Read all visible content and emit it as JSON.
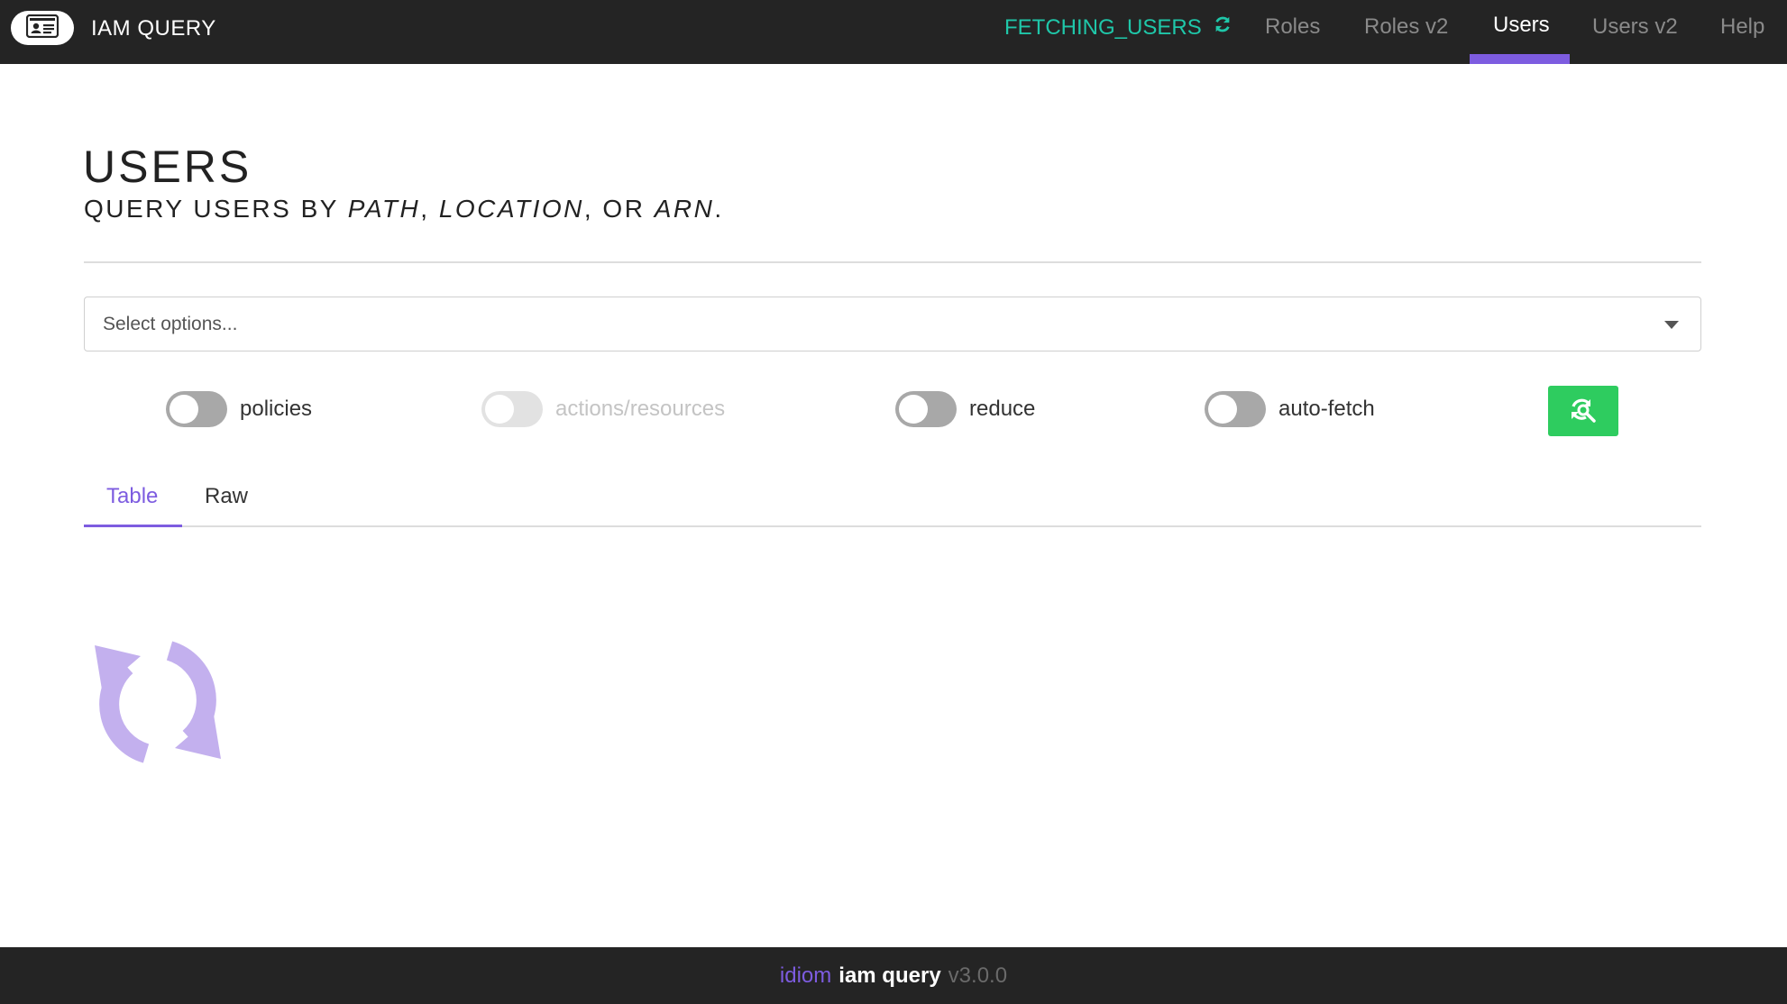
{
  "header": {
    "logo_icon": "id-card-icon",
    "title": "IAM QUERY",
    "status": {
      "text": "FETCHING_USERS",
      "icon": "refresh-icon",
      "color": "#1fc7a9"
    },
    "nav": [
      {
        "label": "Roles",
        "active": false
      },
      {
        "label": "Roles v2",
        "active": false
      },
      {
        "label": "Users",
        "active": true
      },
      {
        "label": "Users v2",
        "active": false
      },
      {
        "label": "Help",
        "active": false
      }
    ],
    "accent_color": "#7d5ce0"
  },
  "page": {
    "title": "USERS",
    "subtitle": {
      "prefix": "QUERY USERS BY ",
      "path": "PATH",
      "sep1": ", ",
      "location": "LOCATION",
      "sep2": ", OR ",
      "arn": "ARN",
      "suffix": "."
    }
  },
  "select": {
    "placeholder": "Select options..."
  },
  "toggles": [
    {
      "label": "policies",
      "enabled": true,
      "on": false
    },
    {
      "label": "actions/resources",
      "enabled": false,
      "on": false
    },
    {
      "label": "reduce",
      "enabled": true,
      "on": false
    },
    {
      "label": "auto-fetch",
      "enabled": true,
      "on": false
    }
  ],
  "search_button": {
    "icon": "search-refresh-icon",
    "color": "#2ecc5f"
  },
  "tabs": [
    {
      "label": "Table",
      "active": true
    },
    {
      "label": "Raw",
      "active": false
    }
  ],
  "loading": {
    "icon": "loading-refresh-icon",
    "color": "#c3b0ee"
  },
  "footer": {
    "brand": "idiom",
    "product": "iam query",
    "version": "v3.0.0"
  }
}
